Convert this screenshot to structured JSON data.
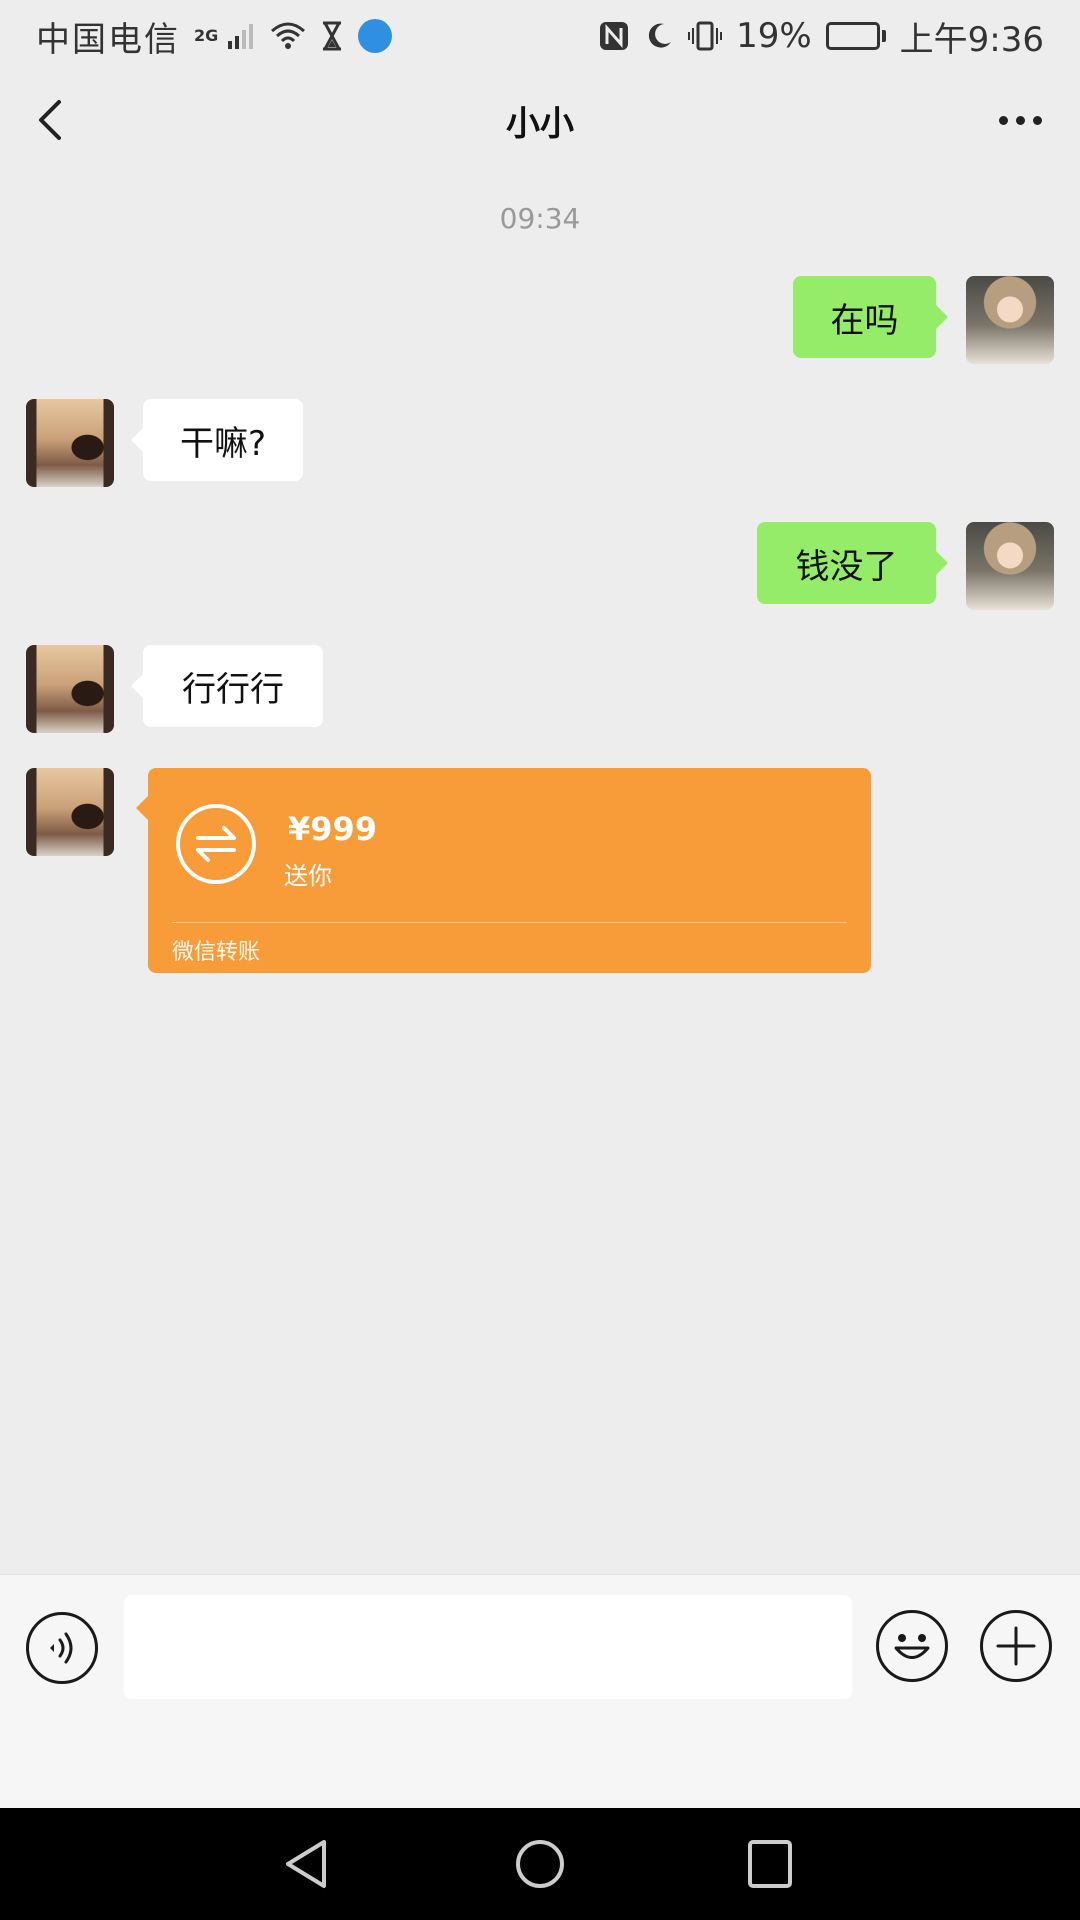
{
  "status_bar": {
    "carrier": "中国电信",
    "network": "2G",
    "battery_text": "19%",
    "battery_level": 0.19,
    "time": "上午9:36",
    "icons": [
      "signal-icon",
      "wifi-icon",
      "hourglass-icon",
      "globe-icon",
      "nfc-icon",
      "moon-icon",
      "vibrate-icon",
      "battery-icon"
    ]
  },
  "header": {
    "title": "小小",
    "back_icon": "chevron-left-icon",
    "more_icon": "more-dots-icon"
  },
  "chat": {
    "timestamp": "09:34",
    "messages": [
      {
        "side": "right",
        "text": "在吗"
      },
      {
        "side": "left",
        "text": "干嘛?"
      },
      {
        "side": "right",
        "text": "钱没了"
      },
      {
        "side": "left",
        "text": "行行行"
      }
    ],
    "transfer": {
      "amount": "¥999",
      "note": "送你",
      "label": "微信转账",
      "color": "#f79c39"
    }
  },
  "input_bar": {
    "value": "",
    "placeholder": ""
  },
  "colors": {
    "background": "#ededed",
    "bubble_sent": "#95ec69",
    "bubble_received": "#ffffff"
  }
}
